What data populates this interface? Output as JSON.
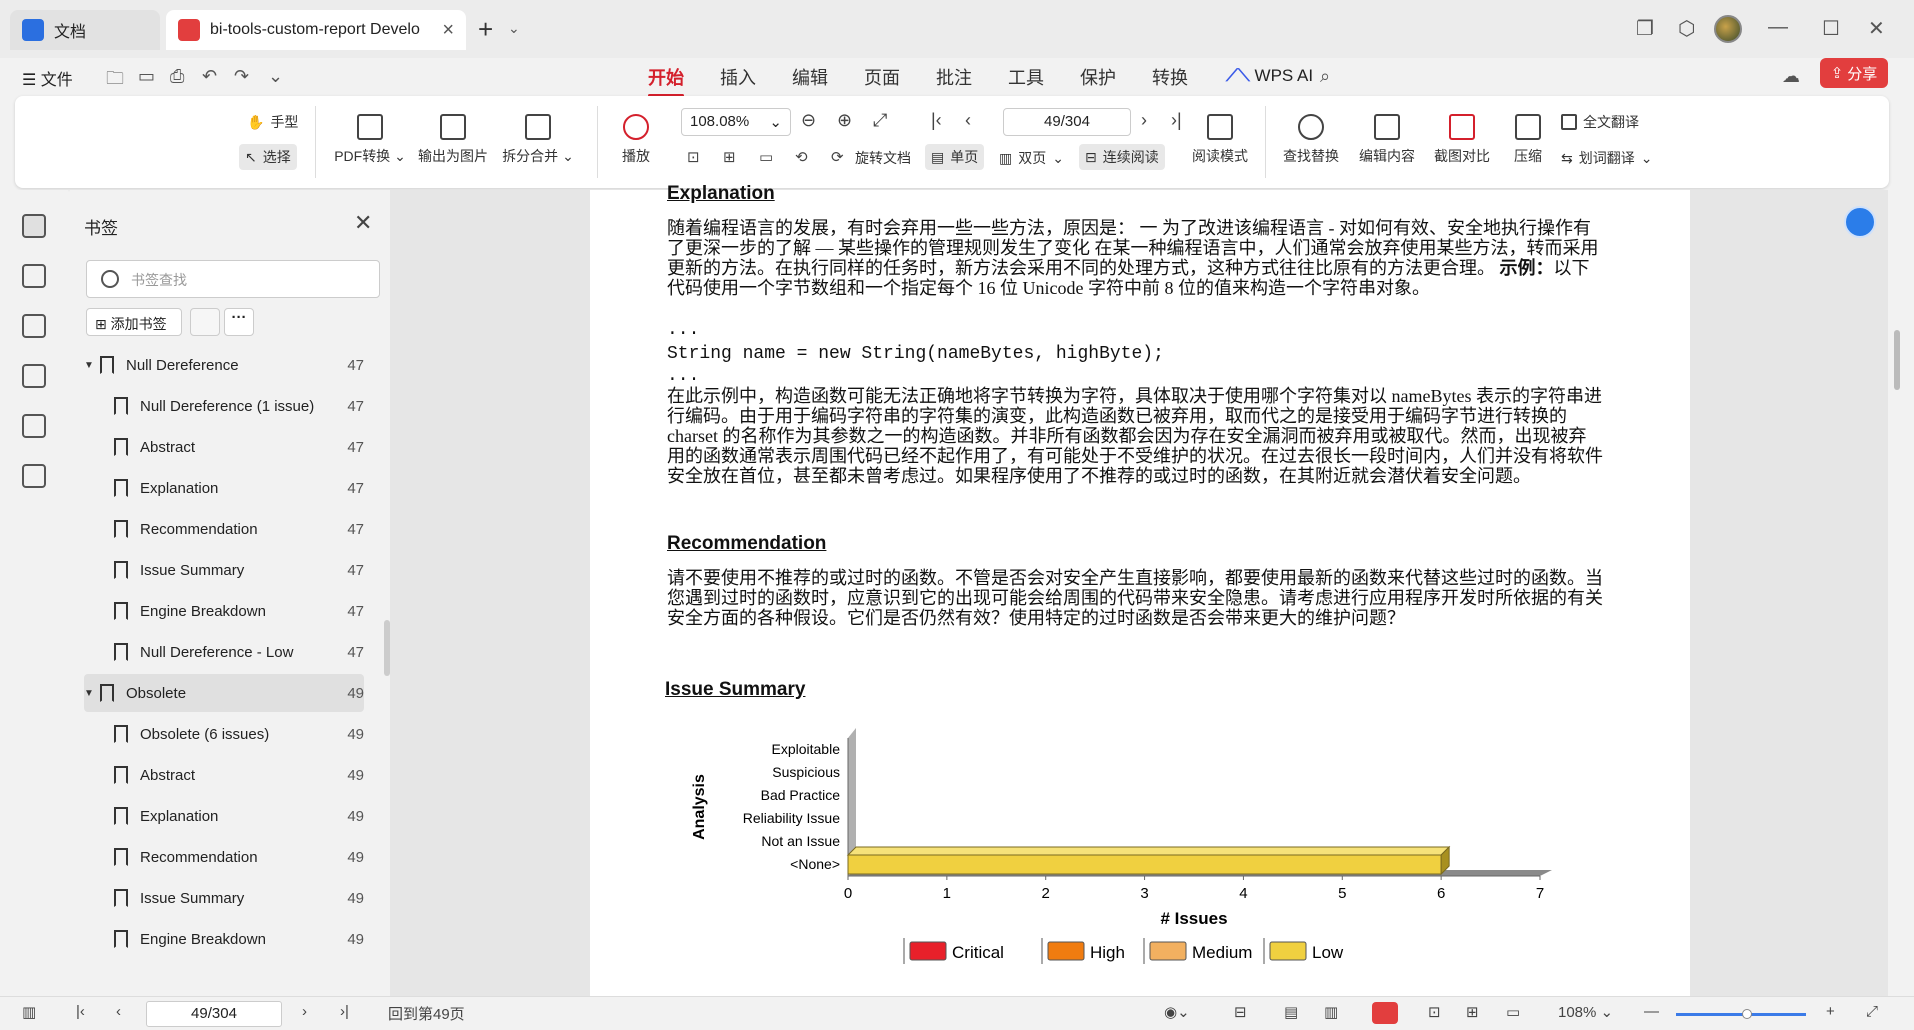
{
  "tabs": [
    {
      "label": "文档"
    },
    {
      "label": "bi-tools-custom-report Develo"
    }
  ],
  "menu": {
    "file": "文件",
    "tabs": [
      "开始",
      "插入",
      "编辑",
      "页面",
      "批注",
      "工具",
      "保护",
      "转换"
    ],
    "wps_ai": "WPS AI",
    "share": "分享"
  },
  "ribbon": {
    "hand": "手型",
    "select": "选择",
    "pdf_convert": "PDF转换",
    "export_image": "输出为图片",
    "split_merge": "拆分合并",
    "play": "播放",
    "zoom": "108.08%",
    "page": "49/304",
    "rotate": "旋转文档",
    "single": "单页",
    "double": "双页",
    "continuous": "连续阅读",
    "read_mode": "阅读模式",
    "find_replace": "查找替换",
    "edit_content": "编辑内容",
    "screenshot": "截图对比",
    "compress": "压缩",
    "full_translate": "全文翻译",
    "word_translate": "划词翻译"
  },
  "bookmarks": {
    "title": "书签",
    "search_placeholder": "书签查找",
    "add": "添加书签",
    "items": [
      {
        "label": "Null Dereference",
        "page": "47",
        "level": 0,
        "expanded": true
      },
      {
        "label": "Null Dereference (1 issue)",
        "page": "47",
        "level": 1
      },
      {
        "label": "Abstract",
        "page": "47",
        "level": 1
      },
      {
        "label": "Explanation",
        "page": "47",
        "level": 1
      },
      {
        "label": "Recommendation",
        "page": "47",
        "level": 1
      },
      {
        "label": "Issue Summary",
        "page": "47",
        "level": 1
      },
      {
        "label": "Engine Breakdown",
        "page": "47",
        "level": 1
      },
      {
        "label": "Null Dereference - Low",
        "page": "47",
        "level": 1
      },
      {
        "label": "Obsolete",
        "page": "49",
        "level": 0,
        "expanded": true,
        "selected": true
      },
      {
        "label": "Obsolete (6 issues)",
        "page": "49",
        "level": 1
      },
      {
        "label": "Abstract",
        "page": "49",
        "level": 1
      },
      {
        "label": "Explanation",
        "page": "49",
        "level": 1
      },
      {
        "label": "Recommendation",
        "page": "49",
        "level": 1
      },
      {
        "label": "Issue Summary",
        "page": "49",
        "level": 1
      },
      {
        "label": "Engine Breakdown",
        "page": "49",
        "level": 1
      }
    ]
  },
  "doc": {
    "explanation_heading": "Explanation",
    "explanation_text": "随着编程语言的发展，有时会弃用一些一些方法，原因是： 一 为了改进该编程语言 - 对如何有效、安全地执行操作有了更深一步的了解 — 某些操作的管理规则发生了变化 在某一种编程语言中，人们通常会放弃使用某些方法，转而采用更新的方法。在执行同样的任务时，新方法会采用不同的处理方式，这种方式往往比原有的方法更合理。",
    "example_label": "示例：",
    "example_text": "以下代码使用一个字节数组和一个指定每个 16 位 Unicode 字符中前 8 位的值来构造一个字符串对象。",
    "ellipsis": "...",
    "code": "String name = new String(nameBytes, highByte);",
    "explanation_text2": "在此示例中，构造函数可能无法正确地将字节转换为字符，具体取决于使用哪个字符集对以 nameBytes 表示的字符串进行编码。由于用于编码字符串的字符集的演变，此构造函数已被弃用，取而代之的是接受用于编码字节进行转换的 charset 的名称作为其参数之一的构造函数。并非所有函数都会因为存在安全漏洞而被弃用或被取代。然而，出现被弃用的函数通常表示周围代码已经不起作用了，有可能处于不受维护的状况。在过去很长一段时间内，人们并没有将软件安全放在首位，甚至都未曾考虑过。如果程序使用了不推荐的或过时的函数，在其附近就会潜伏着安全问题。",
    "recommendation_heading": "Recommendation",
    "recommendation_text": "请不要使用不推荐的或过时的函数。不管是否会对安全产生直接影响，都要使用最新的函数来代替这些过时的函数。当您遇到过时的函数时，应意识到它的出现可能会给周围的代码带来安全隐患。请考虑进行应用程序开发时所依据的有关安全方面的各种假设。它们是否仍然有效？使用特定的过时函数是否会带来更大的维护问题？",
    "issue_summary_heading": "Issue Summary"
  },
  "chart_data": {
    "type": "bar",
    "orientation": "horizontal",
    "categories": [
      "Exploitable",
      "Suspicious",
      "Bad Practice",
      "Reliability Issue",
      "Not an Issue",
      "<None>"
    ],
    "series": [
      {
        "name": "Critical",
        "color": "#e8202a",
        "values": [
          0,
          0,
          0,
          0,
          0,
          0
        ]
      },
      {
        "name": "High",
        "color": "#f07c10",
        "values": [
          0,
          0,
          0,
          0,
          0,
          0
        ]
      },
      {
        "name": "Medium",
        "color": "#f2b060",
        "values": [
          0,
          0,
          0,
          0,
          0,
          0
        ]
      },
      {
        "name": "Low",
        "color": "#f0d040",
        "values": [
          0,
          0,
          0,
          0,
          0,
          6
        ]
      }
    ],
    "xlabel": "# Issues",
    "ylabel": "Analysis",
    "xlim": [
      0,
      7
    ],
    "xticks": [
      0,
      1,
      2,
      3,
      4,
      5,
      6,
      7
    ],
    "legend": "bottom"
  },
  "status": {
    "page": "49/304",
    "goto": "回到第49页",
    "zoom": "108%"
  }
}
